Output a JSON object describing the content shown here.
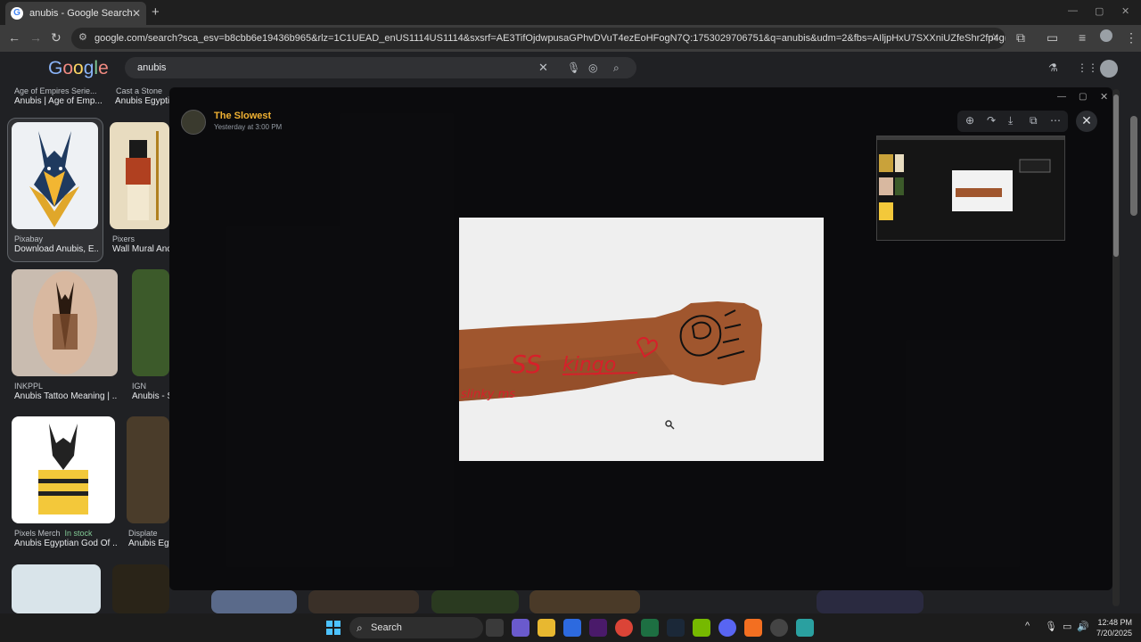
{
  "browser": {
    "tab_title": "anubis - Google Search",
    "tab_favicon": "G",
    "close_glyph": "✕",
    "new_tab_glyph": "+",
    "url": "google.com/search?sca_esv=b8cbb6e19436b965&rlz=1C1UEAD_enUS1114US1114&sxsrf=AE3TifOjdwpusaGPhvDVuT4ezEoHFogN7Q:1753029706751&q=anubis&udm=2&fbs=AIljpHxU7SXXniUZfeShr2fp4giZ1Y6MJ25_tmWITc7uy4Kleioyp3..."
  },
  "google": {
    "logo_letters": [
      "G",
      "o",
      "o",
      "g",
      "l",
      "e"
    ],
    "logo_colors": [
      "#8ab4f8",
      "#f28b82",
      "#fdd663",
      "#8ab4f8",
      "#81c995",
      "#f28b82"
    ],
    "query": "anubis"
  },
  "results": {
    "top_row": [
      {
        "source": "Age of Empires Serie...",
        "title": "Anubis | Age of Emp..."
      },
      {
        "source": "Cast a Stone",
        "title": "Anubis Egypti..."
      }
    ],
    "items": [
      {
        "source": "Pixabay",
        "title": "Download Anubis, E..."
      },
      {
        "source": "Pixers",
        "title": "Wall Mural Anc..."
      },
      {
        "source": "INKPPL",
        "title": "Anubis Tattoo Meaning | ..."
      },
      {
        "source": "IGN",
        "title": "Anubis - S..."
      },
      {
        "source": "Pixels Merch",
        "stock": "In stock",
        "title": "Anubis Egyptian God Of ..."
      },
      {
        "source": "Displate",
        "title": "Anubis Egy..."
      }
    ]
  },
  "viewer": {
    "user": "The Slowest",
    "timestamp": "Yesterday at 3:00 PM",
    "drawn_text_1": "SS",
    "drawn_text_2": "kingo",
    "drawn_text_3": "slinky ms"
  },
  "taskbar": {
    "search_label": "Search",
    "time": "12:48 PM",
    "date": "7/20/2025"
  }
}
